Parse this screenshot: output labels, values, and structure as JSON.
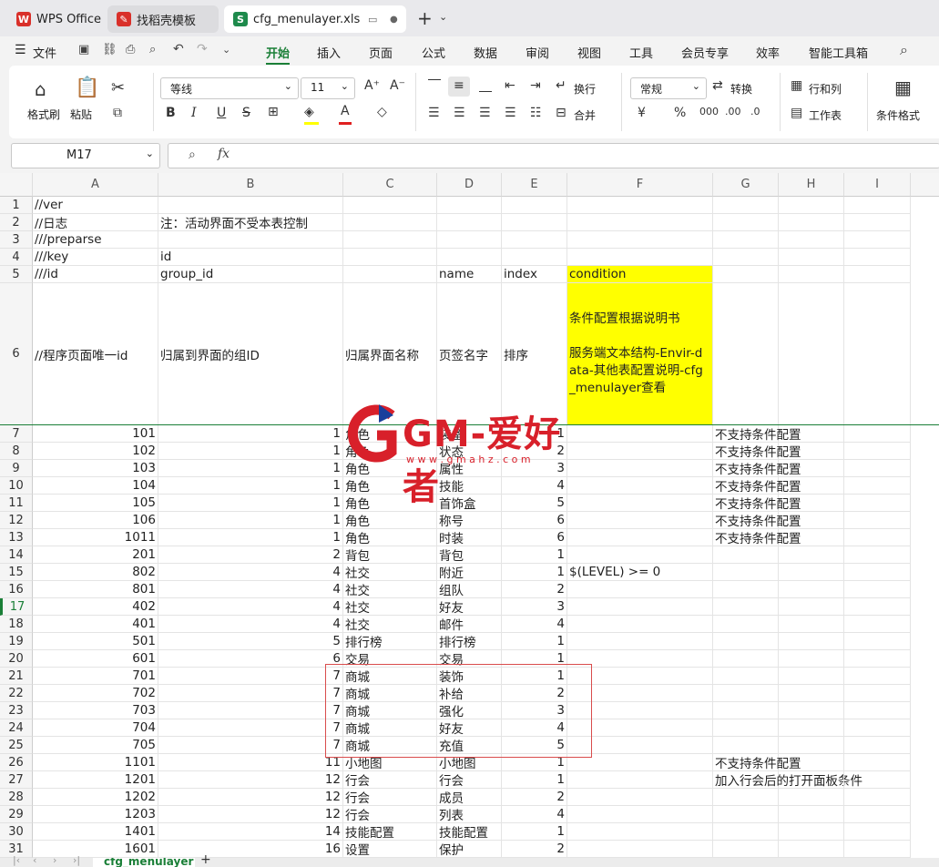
{
  "tabs": [
    {
      "label": "WPS Office",
      "color": "#d9302a",
      "icon": "W"
    },
    {
      "label": "找稻壳模板",
      "color": "#d9302a",
      "icon": "✎"
    },
    {
      "label": "cfg_menulayer.xls",
      "color": "#1e8a4c",
      "icon": "S"
    }
  ],
  "menu": {
    "file": "文件",
    "items": [
      "开始",
      "插入",
      "页面",
      "公式",
      "数据",
      "审阅",
      "视图",
      "工具",
      "会员专享",
      "效率",
      "智能工具箱"
    ]
  },
  "ribbon": {
    "format_painter": "格式刷",
    "paste": "粘贴",
    "font": "等线",
    "size": "11",
    "wrap": "换行",
    "merge": "合并",
    "number_format": "常规",
    "convert": "转换",
    "rowcol": "行和列",
    "worksheet": "工作表",
    "cond_format": "条件格式",
    "bold": "B",
    "italic": "I",
    "underline": "U",
    "strike": "S"
  },
  "formula": {
    "cell_ref": "M17",
    "fx": "fx",
    "value": ""
  },
  "columns": [
    "A",
    "B",
    "C",
    "D",
    "E",
    "F",
    "G",
    "H",
    "I"
  ],
  "rows": [
    {
      "n": "1",
      "A": "//ver"
    },
    {
      "n": "2",
      "A": "//日志",
      "B": "注：活动界面不受本表控制"
    },
    {
      "n": "3",
      "A": "///preparse"
    },
    {
      "n": "4",
      "A": "///key",
      "B": "id"
    },
    {
      "n": "5",
      "A": "///id",
      "B": "group_id",
      "D": "name",
      "E": "index",
      "F": "condition"
    },
    {
      "n": "6",
      "A": "//程序页面唯一id",
      "B": "归属到界面的组ID",
      "C": "归属界面名称",
      "D": "页签名字",
      "E": "排序",
      "F": "条件配置根据说明书\n\n服务端文本结构-Envir-data-其他表配置说明-cfg_menulayer查看"
    },
    {
      "n": "7",
      "A": "101",
      "B": "1",
      "C": "角色",
      "D": "装备",
      "E": "1",
      "G": "不支持条件配置"
    },
    {
      "n": "8",
      "A": "102",
      "B": "1",
      "C": "角色",
      "D": "状态",
      "E": "2",
      "G": "不支持条件配置"
    },
    {
      "n": "9",
      "A": "103",
      "B": "1",
      "C": "角色",
      "D": "属性",
      "E": "3",
      "G": "不支持条件配置"
    },
    {
      "n": "10",
      "A": "104",
      "B": "1",
      "C": "角色",
      "D": "技能",
      "E": "4",
      "G": "不支持条件配置"
    },
    {
      "n": "11",
      "A": "105",
      "B": "1",
      "C": "角色",
      "D": "首饰盒",
      "E": "5",
      "G": "不支持条件配置"
    },
    {
      "n": "12",
      "A": "106",
      "B": "1",
      "C": "角色",
      "D": "称号",
      "E": "6",
      "G": "不支持条件配置"
    },
    {
      "n": "13",
      "A": "1011",
      "B": "1",
      "C": "角色",
      "D": "时装",
      "E": "6",
      "G": "不支持条件配置"
    },
    {
      "n": "14",
      "A": "201",
      "B": "2",
      "C": "背包",
      "D": "背包",
      "E": "1"
    },
    {
      "n": "15",
      "A": "802",
      "B": "4",
      "C": "社交",
      "D": "附近",
      "E": "1",
      "F": "$(LEVEL) >= 0"
    },
    {
      "n": "16",
      "A": "801",
      "B": "4",
      "C": "社交",
      "D": "组队",
      "E": "2"
    },
    {
      "n": "17",
      "A": "402",
      "B": "4",
      "C": "社交",
      "D": "好友",
      "E": "3"
    },
    {
      "n": "18",
      "A": "401",
      "B": "4",
      "C": "社交",
      "D": "邮件",
      "E": "4"
    },
    {
      "n": "19",
      "A": "501",
      "B": "5",
      "C": "排行榜",
      "D": "排行榜",
      "E": "1"
    },
    {
      "n": "20",
      "A": "601",
      "B": "6",
      "C": "交易",
      "D": "交易",
      "E": "1"
    },
    {
      "n": "21",
      "A": "701",
      "B": "7",
      "C": "商城",
      "D": "装饰",
      "E": "1"
    },
    {
      "n": "22",
      "A": "702",
      "B": "7",
      "C": "商城",
      "D": "补给",
      "E": "2"
    },
    {
      "n": "23",
      "A": "703",
      "B": "7",
      "C": "商城",
      "D": "强化",
      "E": "3"
    },
    {
      "n": "24",
      "A": "704",
      "B": "7",
      "C": "商城",
      "D": "好友",
      "E": "4"
    },
    {
      "n": "25",
      "A": "705",
      "B": "7",
      "C": "商城",
      "D": "充值",
      "E": "5"
    },
    {
      "n": "26",
      "A": "1101",
      "B": "11",
      "C": "小地图",
      "D": "小地图",
      "E": "1",
      "G": "不支持条件配置"
    },
    {
      "n": "27",
      "A": "1201",
      "B": "12",
      "C": "行会",
      "D": "行会",
      "E": "1",
      "G": "加入行会后的打开面板条件"
    },
    {
      "n": "28",
      "A": "1202",
      "B": "12",
      "C": "行会",
      "D": "成员",
      "E": "2"
    },
    {
      "n": "29",
      "A": "1203",
      "B": "12",
      "C": "行会",
      "D": "列表",
      "E": "4"
    },
    {
      "n": "30",
      "A": "1401",
      "B": "14",
      "C": "技能配置",
      "D": "技能配置",
      "E": "1"
    },
    {
      "n": "31",
      "A": "1601",
      "B": "16",
      "C": "设置",
      "D": "保护",
      "E": "2"
    }
  ],
  "watermark": {
    "text": "GM-爱好者",
    "sub": "w w w . g m a h z . c o m"
  },
  "sheet_tab": "cfg_menulayer",
  "colors": {
    "highlight": "#ffff00",
    "accent": "#1a7f37",
    "selection_box": "#d94c4c"
  }
}
